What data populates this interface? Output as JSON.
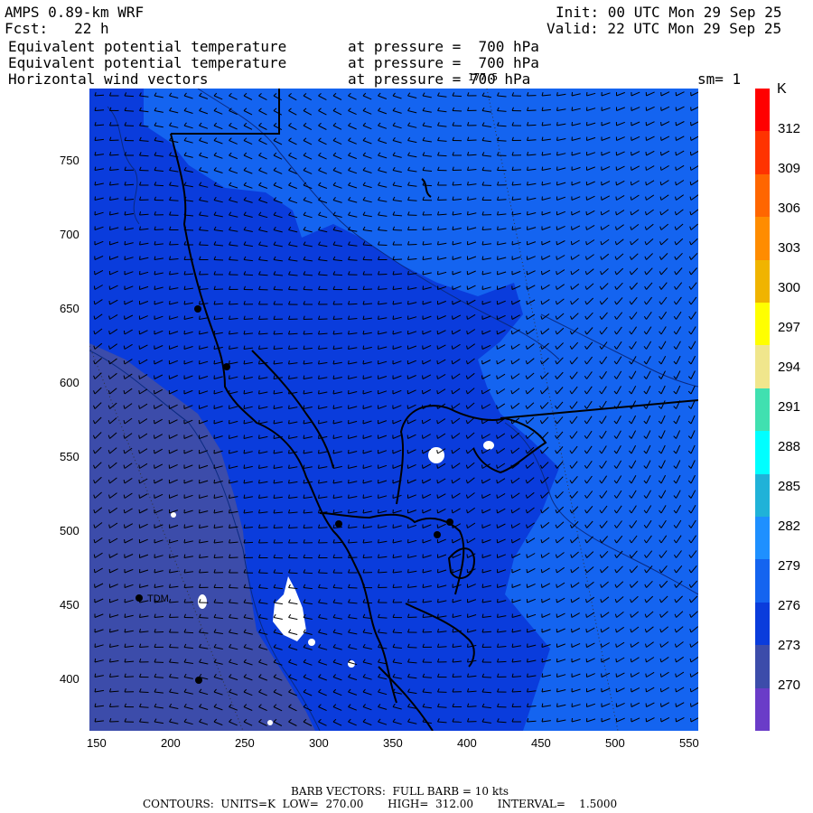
{
  "header": {
    "model": "AMPS 0.89-km WRF",
    "forecast": "Fcst:   22 h",
    "init": "Init: 00 UTC Mon 29 Sep 25",
    "valid": "Valid: 22 UTC Mon 29 Sep 25",
    "field1_name": "Equivalent potential temperature",
    "field1_level": "at pressure =  700 hPa",
    "field2_name": "Equivalent potential temperature",
    "field2_level": "at pressure =  700 hPa",
    "field3_name": "Horizontal wind vectors",
    "field3_level": "at pressure = 700 hPa",
    "smoothing": "sm= 1",
    "longitude_marker": "177.5"
  },
  "axes": {
    "x_ticks": [
      "150",
      "200",
      "250",
      "300",
      "350",
      "400",
      "450",
      "500",
      "550"
    ],
    "y_ticks": [
      "750",
      "700",
      "650",
      "600",
      "550",
      "500",
      "450",
      "400"
    ]
  },
  "colorbar": {
    "unit": "K",
    "labels": [
      "312",
      "309",
      "306",
      "303",
      "300",
      "297",
      "294",
      "291",
      "288",
      "285",
      "282",
      "279",
      "276",
      "273",
      "270"
    ],
    "colors": [
      "#ff0000",
      "#ff3300",
      "#ff6600",
      "#ff8c00",
      "#f0b400",
      "#ffff00",
      "#f0e68c",
      "#40e0b0",
      "#00ffff",
      "#20b2d8",
      "#1e90ff",
      "#1464f0",
      "#0a3cdc",
      "#3c4caa",
      "#6a3cc8"
    ]
  },
  "map": {
    "station_label": "TDM",
    "colors": {
      "band_276": "#0a3cdc",
      "band_279": "#1464f0",
      "band_273": "#3c4caa",
      "missing": "#ffffff"
    }
  },
  "footer": {
    "barb_legend": "BARB VECTORS:  FULL BARB = 10 kts",
    "contours_legend": "CONTOURS:  UNITS=K  LOW=  270.00       HIGH=  312.00       INTERVAL=    1.5000"
  }
}
